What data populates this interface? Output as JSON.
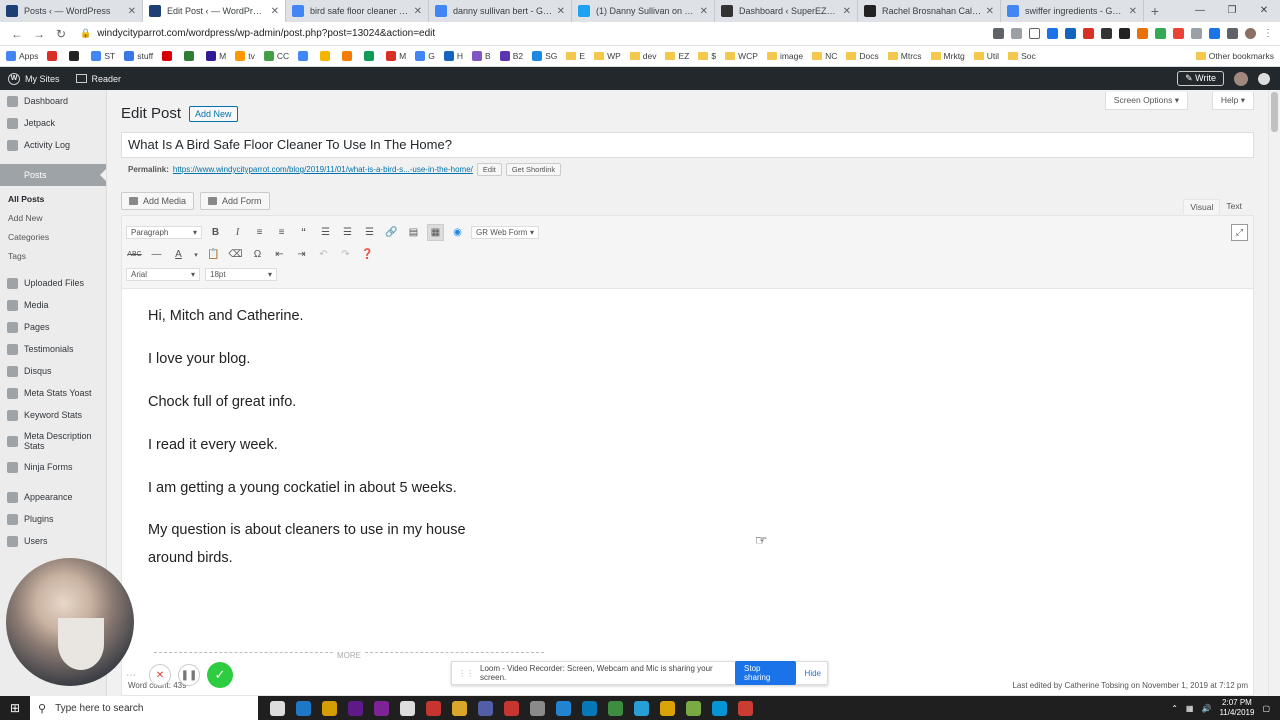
{
  "browser": {
    "tabs": [
      {
        "title": "Posts ‹ — WordPress",
        "color": "#1c3f75"
      },
      {
        "title": "Edit Post ‹ — WordPress",
        "color": "#1c3f75",
        "active": true
      },
      {
        "title": "bird safe floor cleaner - Google",
        "color": "#4285f4"
      },
      {
        "title": "danny sullivan bert - Google",
        "color": "#4285f4"
      },
      {
        "title": "(1) Danny Sullivan on Twitter",
        "color": "#1da1f2"
      },
      {
        "title": "Dashboard ‹ SuperEZSystem",
        "color": "#333333"
      },
      {
        "title": "Rachel Brosnahan Call Center",
        "color": "#222222"
      },
      {
        "title": "swiffer ingredients - Google",
        "color": "#4285f4"
      }
    ],
    "url": "windycityparrot.com/wordpress/wp-admin/post.php?post=13024&action=edit",
    "bookmarks": [
      {
        "label": "Apps",
        "color": "#4285f4"
      },
      {
        "label": "",
        "color": "#d93025"
      },
      {
        "label": "",
        "color": "#222222"
      },
      {
        "label": "ST",
        "color": "#4285f4"
      },
      {
        "label": "stuff",
        "color": "#3b78e7",
        "folder": false
      },
      {
        "label": "",
        "color": "#d50000"
      },
      {
        "label": "",
        "color": "#2e7d32"
      },
      {
        "label": "M",
        "color": "#311b92"
      },
      {
        "label": "tv",
        "color": "#ff9800"
      },
      {
        "label": "CC",
        "color": "#43a047"
      },
      {
        "label": "",
        "color": "#4285f4"
      },
      {
        "label": "",
        "color": "#f4b400"
      },
      {
        "label": "",
        "color": "#f57c00"
      },
      {
        "label": "",
        "color": "#0f9d58"
      },
      {
        "label": "M",
        "color": "#d93025"
      },
      {
        "label": "G",
        "color": "#4285f4"
      },
      {
        "label": "H",
        "color": "#1565c0"
      },
      {
        "label": "B",
        "color": "#7e57c2"
      },
      {
        "label": "B2",
        "color": "#5e35b1"
      },
      {
        "label": "SG",
        "color": "#1e88e5"
      },
      {
        "label": "E",
        "folder": true
      },
      {
        "label": "WP",
        "folder": true
      },
      {
        "label": "dev",
        "folder": true
      },
      {
        "label": "EZ",
        "folder": true
      },
      {
        "label": "$",
        "folder": true
      },
      {
        "label": "WCP",
        "folder": true
      },
      {
        "label": "image",
        "folder": true
      },
      {
        "label": "NC",
        "folder": true
      },
      {
        "label": "Docs",
        "folder": true
      },
      {
        "label": "Mtrcs",
        "folder": true
      },
      {
        "label": "Mrktg",
        "folder": true
      },
      {
        "label": "Util",
        "folder": true
      },
      {
        "label": "Soc",
        "folder": true
      }
    ],
    "other_bookmarks": "Other bookmarks"
  },
  "adminbar": {
    "my_sites": "My Sites",
    "reader": "Reader",
    "write": "Write"
  },
  "sidebar": {
    "items_top": [
      "Dashboard",
      "Jetpack",
      "Activity Log"
    ],
    "current": "Posts",
    "submenu": [
      "All Posts",
      "Add New",
      "Categories",
      "Tags"
    ],
    "items_bottom": [
      "Uploaded Files",
      "Media",
      "Pages",
      "Testimonials",
      "Disqus",
      "Meta Stats Yoast",
      "Keyword Stats",
      "Meta Description Stats",
      "Ninja Forms",
      "Appearance",
      "Plugins",
      "Users"
    ]
  },
  "main": {
    "screen_options": "Screen Options ▾",
    "help": "Help ▾",
    "page_title": "Edit Post",
    "add_new": "Add New",
    "post_title": "What Is A Bird Safe Floor Cleaner To Use In The Home?",
    "permalink_label": "Permalink:",
    "permalink_url": "https://www.windycityparrot.com/blog/2019/11/01/what-is-a-bird-s...-use-in-the-home/",
    "permalink_edit": "Edit",
    "get_shortlink": "Get Shortlink",
    "add_media": "Add Media",
    "add_form": "Add Form",
    "tab_visual": "Visual",
    "tab_text": "Text"
  },
  "toolbar": {
    "format": "Paragraph",
    "gr_form": "GR Web Form",
    "font": "Arial",
    "size": "18pt"
  },
  "content": {
    "p1": "Hi, Mitch and Catherine.",
    "p2": "I love your blog.",
    "p3": "Chock full of great info.",
    "p4": "I read it every week.",
    "p5": "I am getting a young cockatiel in about 5 weeks.",
    "p6": "My question is about cleaners to use in my house around birds.",
    "more": "MORE"
  },
  "footer": {
    "word_count": "Word count: 439",
    "last_edited": "Last edited by Catherine Tobsing on November 1, 2019 at 7:12 pm"
  },
  "loom": {
    "message": "Loom - Video Recorder: Screen, Webcam and Mic is sharing your screen.",
    "stop": "Stop sharing",
    "hide": "Hide"
  },
  "taskbar": {
    "search_placeholder": "Type here to search",
    "time": "2:07 PM",
    "date": "11/4/2019",
    "apps": [
      "#ffffff",
      "#1e88e5",
      "#f4b400",
      "#6a1b9a",
      "#8e24aa",
      "#ffffff",
      "#e53935",
      "#fbc02d",
      "#5c6bc0",
      "#e53935",
      "#9e9e9e",
      "#2196f3",
      "#0288d1",
      "#43a047",
      "#29b6f6",
      "#fbbc05",
      "#8bc34a",
      "#03a9f4",
      "#ea4335"
    ]
  }
}
